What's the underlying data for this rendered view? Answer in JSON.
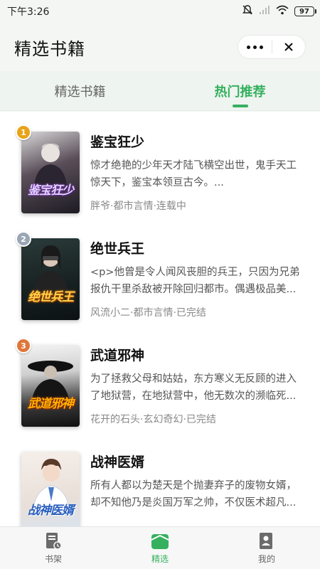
{
  "status_bar": {
    "time": "下午3:26",
    "battery": "97"
  },
  "nav": {
    "title": "精选书籍"
  },
  "tabs": [
    {
      "label": "精选书籍",
      "active": false
    },
    {
      "label": "热门推荐",
      "active": true
    }
  ],
  "books": [
    {
      "rank": "1",
      "title": "鉴宝狂少",
      "cover_text": "鉴宝狂少",
      "desc": "惊才绝艳的少年天才陆飞横空出世，鬼手天工惊天下，鉴宝本领亘古今。...",
      "meta": "胖爷·都市言情·连载中"
    },
    {
      "rank": "2",
      "title": "绝世兵王",
      "cover_text": "绝世兵王",
      "desc": "<p>他曾是令人闻风丧胆的兵王，只因为兄弟报仇干里杀敌被开除回归都市。偶遇极品美...",
      "meta": "风流小二·都市言情·已完结"
    },
    {
      "rank": "3",
      "title": "武道邪神",
      "cover_text": "武道邪神",
      "desc": "为了拯救父母和姑姑，东方寒义无反顾的进入了地狱营，在地狱营中，他无数次的濒临死...",
      "meta": "花开的石头·玄幻奇幻·已完结"
    },
    {
      "rank": "",
      "title": "战神医婿",
      "cover_text": "战神医婿",
      "desc": "所有人都以为楚天是个抛妻弃子的废物女婿，却不知他乃是炎国万军之帅，不仅医术超凡...",
      "meta": ""
    }
  ],
  "tab_bar": [
    {
      "label": "书架",
      "icon": "bookshelf-icon",
      "active": false
    },
    {
      "label": "精选",
      "icon": "featured-icon",
      "active": true
    },
    {
      "label": "我的",
      "icon": "profile-icon",
      "active": false
    }
  ],
  "colors": {
    "accent": "#35b05f",
    "rank1": "#e8a317",
    "rank2": "#9aa6b4",
    "rank3": "#e0763a"
  }
}
